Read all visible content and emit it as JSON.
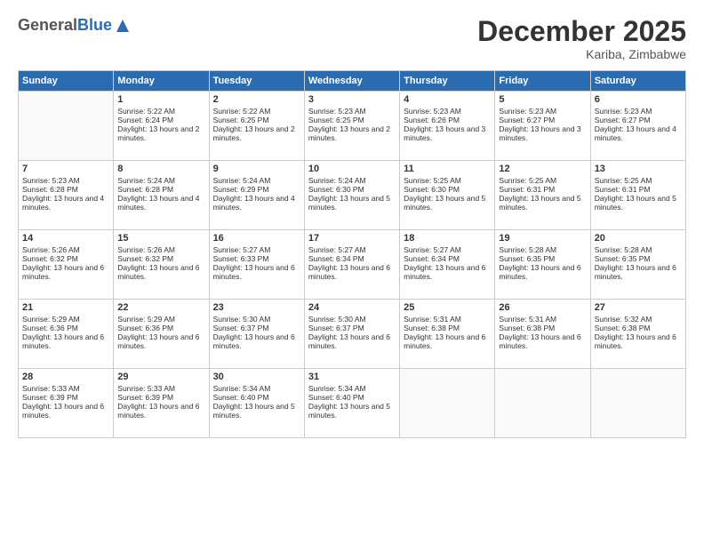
{
  "logo": {
    "general": "General",
    "blue": "Blue"
  },
  "title": "December 2025",
  "subtitle": "Kariba, Zimbabwe",
  "headers": [
    "Sunday",
    "Monday",
    "Tuesday",
    "Wednesday",
    "Thursday",
    "Friday",
    "Saturday"
  ],
  "weeks": [
    [
      {
        "day": "",
        "sunrise": "",
        "sunset": "",
        "daylight": ""
      },
      {
        "day": "1",
        "sunrise": "Sunrise: 5:22 AM",
        "sunset": "Sunset: 6:24 PM",
        "daylight": "Daylight: 13 hours and 2 minutes."
      },
      {
        "day": "2",
        "sunrise": "Sunrise: 5:22 AM",
        "sunset": "Sunset: 6:25 PM",
        "daylight": "Daylight: 13 hours and 2 minutes."
      },
      {
        "day": "3",
        "sunrise": "Sunrise: 5:23 AM",
        "sunset": "Sunset: 6:25 PM",
        "daylight": "Daylight: 13 hours and 2 minutes."
      },
      {
        "day": "4",
        "sunrise": "Sunrise: 5:23 AM",
        "sunset": "Sunset: 6:26 PM",
        "daylight": "Daylight: 13 hours and 3 minutes."
      },
      {
        "day": "5",
        "sunrise": "Sunrise: 5:23 AM",
        "sunset": "Sunset: 6:27 PM",
        "daylight": "Daylight: 13 hours and 3 minutes."
      },
      {
        "day": "6",
        "sunrise": "Sunrise: 5:23 AM",
        "sunset": "Sunset: 6:27 PM",
        "daylight": "Daylight: 13 hours and 4 minutes."
      }
    ],
    [
      {
        "day": "7",
        "sunrise": "Sunrise: 5:23 AM",
        "sunset": "Sunset: 6:28 PM",
        "daylight": "Daylight: 13 hours and 4 minutes."
      },
      {
        "day": "8",
        "sunrise": "Sunrise: 5:24 AM",
        "sunset": "Sunset: 6:28 PM",
        "daylight": "Daylight: 13 hours and 4 minutes."
      },
      {
        "day": "9",
        "sunrise": "Sunrise: 5:24 AM",
        "sunset": "Sunset: 6:29 PM",
        "daylight": "Daylight: 13 hours and 4 minutes."
      },
      {
        "day": "10",
        "sunrise": "Sunrise: 5:24 AM",
        "sunset": "Sunset: 6:30 PM",
        "daylight": "Daylight: 13 hours and 5 minutes."
      },
      {
        "day": "11",
        "sunrise": "Sunrise: 5:25 AM",
        "sunset": "Sunset: 6:30 PM",
        "daylight": "Daylight: 13 hours and 5 minutes."
      },
      {
        "day": "12",
        "sunrise": "Sunrise: 5:25 AM",
        "sunset": "Sunset: 6:31 PM",
        "daylight": "Daylight: 13 hours and 5 minutes."
      },
      {
        "day": "13",
        "sunrise": "Sunrise: 5:25 AM",
        "sunset": "Sunset: 6:31 PM",
        "daylight": "Daylight: 13 hours and 5 minutes."
      }
    ],
    [
      {
        "day": "14",
        "sunrise": "Sunrise: 5:26 AM",
        "sunset": "Sunset: 6:32 PM",
        "daylight": "Daylight: 13 hours and 6 minutes."
      },
      {
        "day": "15",
        "sunrise": "Sunrise: 5:26 AM",
        "sunset": "Sunset: 6:32 PM",
        "daylight": "Daylight: 13 hours and 6 minutes."
      },
      {
        "day": "16",
        "sunrise": "Sunrise: 5:27 AM",
        "sunset": "Sunset: 6:33 PM",
        "daylight": "Daylight: 13 hours and 6 minutes."
      },
      {
        "day": "17",
        "sunrise": "Sunrise: 5:27 AM",
        "sunset": "Sunset: 6:34 PM",
        "daylight": "Daylight: 13 hours and 6 minutes."
      },
      {
        "day": "18",
        "sunrise": "Sunrise: 5:27 AM",
        "sunset": "Sunset: 6:34 PM",
        "daylight": "Daylight: 13 hours and 6 minutes."
      },
      {
        "day": "19",
        "sunrise": "Sunrise: 5:28 AM",
        "sunset": "Sunset: 6:35 PM",
        "daylight": "Daylight: 13 hours and 6 minutes."
      },
      {
        "day": "20",
        "sunrise": "Sunrise: 5:28 AM",
        "sunset": "Sunset: 6:35 PM",
        "daylight": "Daylight: 13 hours and 6 minutes."
      }
    ],
    [
      {
        "day": "21",
        "sunrise": "Sunrise: 5:29 AM",
        "sunset": "Sunset: 6:36 PM",
        "daylight": "Daylight: 13 hours and 6 minutes."
      },
      {
        "day": "22",
        "sunrise": "Sunrise: 5:29 AM",
        "sunset": "Sunset: 6:36 PM",
        "daylight": "Daylight: 13 hours and 6 minutes."
      },
      {
        "day": "23",
        "sunrise": "Sunrise: 5:30 AM",
        "sunset": "Sunset: 6:37 PM",
        "daylight": "Daylight: 13 hours and 6 minutes."
      },
      {
        "day": "24",
        "sunrise": "Sunrise: 5:30 AM",
        "sunset": "Sunset: 6:37 PM",
        "daylight": "Daylight: 13 hours and 6 minutes."
      },
      {
        "day": "25",
        "sunrise": "Sunrise: 5:31 AM",
        "sunset": "Sunset: 6:38 PM",
        "daylight": "Daylight: 13 hours and 6 minutes."
      },
      {
        "day": "26",
        "sunrise": "Sunrise: 5:31 AM",
        "sunset": "Sunset: 6:38 PM",
        "daylight": "Daylight: 13 hours and 6 minutes."
      },
      {
        "day": "27",
        "sunrise": "Sunrise: 5:32 AM",
        "sunset": "Sunset: 6:38 PM",
        "daylight": "Daylight: 13 hours and 6 minutes."
      }
    ],
    [
      {
        "day": "28",
        "sunrise": "Sunrise: 5:33 AM",
        "sunset": "Sunset: 6:39 PM",
        "daylight": "Daylight: 13 hours and 6 minutes."
      },
      {
        "day": "29",
        "sunrise": "Sunrise: 5:33 AM",
        "sunset": "Sunset: 6:39 PM",
        "daylight": "Daylight: 13 hours and 6 minutes."
      },
      {
        "day": "30",
        "sunrise": "Sunrise: 5:34 AM",
        "sunset": "Sunset: 6:40 PM",
        "daylight": "Daylight: 13 hours and 5 minutes."
      },
      {
        "day": "31",
        "sunrise": "Sunrise: 5:34 AM",
        "sunset": "Sunset: 6:40 PM",
        "daylight": "Daylight: 13 hours and 5 minutes."
      },
      {
        "day": "",
        "sunrise": "",
        "sunset": "",
        "daylight": ""
      },
      {
        "day": "",
        "sunrise": "",
        "sunset": "",
        "daylight": ""
      },
      {
        "day": "",
        "sunrise": "",
        "sunset": "",
        "daylight": ""
      }
    ]
  ]
}
